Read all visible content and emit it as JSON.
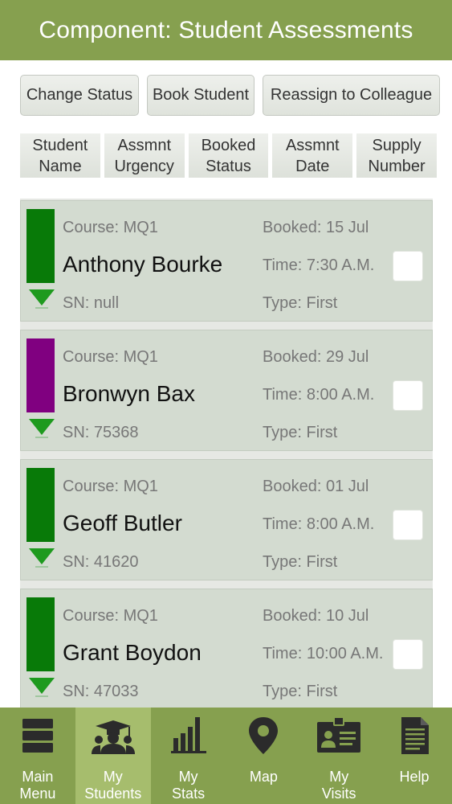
{
  "header": {
    "title": "Component: Student Assessments"
  },
  "actions": {
    "change_status": "Change Status",
    "book_student": "Book Student",
    "reassign": "Reassign to Colleague"
  },
  "sort": [
    {
      "line1": "Student",
      "line2": "Name"
    },
    {
      "line1": "Assmnt",
      "line2": "Urgency"
    },
    {
      "line1": "Booked",
      "line2": "Status"
    },
    {
      "line1": "Assmnt",
      "line2": "Date"
    },
    {
      "line1": "Supply",
      "line2": "Number"
    }
  ],
  "students": [
    {
      "course": "Course: MQ1",
      "name": "Anthony Bourke",
      "sn": "SN: null",
      "booked": "Booked: 15 Jul",
      "time": "Time: 7:30 A.M.",
      "type": "Type: First",
      "status_color": "#087a08"
    },
    {
      "course": "Course: MQ1",
      "name": "Bronwyn Bax",
      "sn": "SN: 75368",
      "booked": "Booked: 29 Jul",
      "time": "Time: 8:00 A.M.",
      "type": "Type: First",
      "status_color": "#800080"
    },
    {
      "course": "Course: MQ1",
      "name": "Geoff Butler",
      "sn": "SN: 41620",
      "booked": "Booked: 01 Jul",
      "time": "Time: 8:00 A.M.",
      "type": "Type: First",
      "status_color": "#087a08"
    },
    {
      "course": "Course: MQ1",
      "name": "Grant Boydon",
      "sn": "SN: 47033",
      "booked": "Booked: 10 Jul",
      "time": "Time: 10:00 A.M.",
      "type": "Type: First",
      "status_color": "#087a08"
    }
  ],
  "urgency_color": "#1e9a1e",
  "nav": [
    {
      "line1": "Main",
      "line2": "Menu",
      "icon": "stack-icon"
    },
    {
      "line1": "My",
      "line2": "Students",
      "icon": "students-icon"
    },
    {
      "line1": "My",
      "line2": "Stats",
      "icon": "bar-chart-icon"
    },
    {
      "line1": "Map",
      "line2": "",
      "icon": "map-pin-icon"
    },
    {
      "line1": "My",
      "line2": "Visits",
      "icon": "id-badge-icon"
    },
    {
      "line1": "Help",
      "line2": "",
      "icon": "document-icon"
    }
  ]
}
